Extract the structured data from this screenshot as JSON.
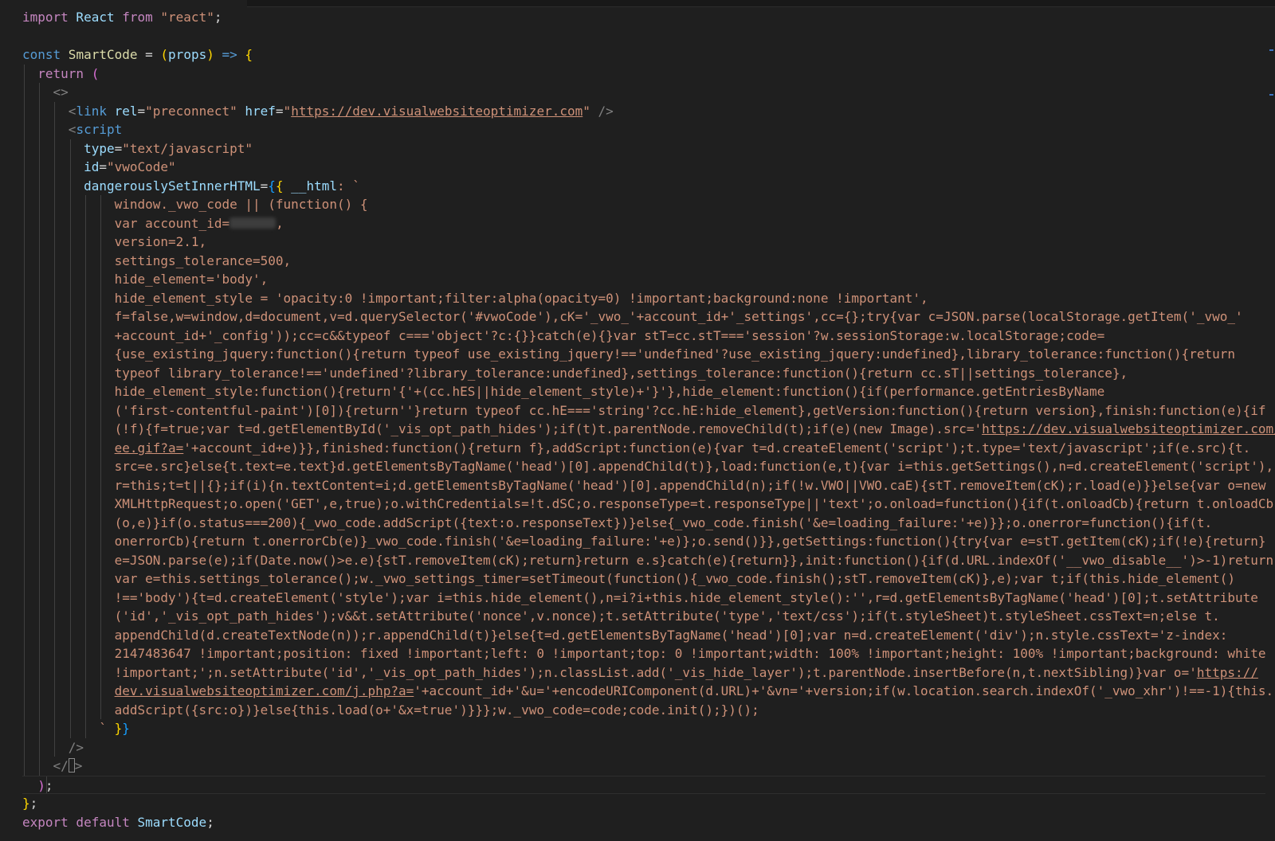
{
  "editor": {
    "file_language": "JSX",
    "lines": [
      [
        [
          "import",
          "ctl"
        ],
        [
          " React ",
          "var"
        ],
        [
          "from",
          "ctl"
        ],
        [
          " \"react\"",
          "str"
        ],
        [
          ";",
          "txt"
        ]
      ],
      [],
      [
        [
          "const",
          "kw"
        ],
        [
          " SmartCode",
          "fn"
        ],
        [
          " = ",
          "txt"
        ],
        [
          "(",
          "br1"
        ],
        [
          "props",
          "var"
        ],
        [
          ")",
          "br1"
        ],
        [
          " => ",
          "kw"
        ],
        [
          "{",
          "br1"
        ]
      ],
      [
        [
          "  ",
          "txt"
        ],
        [
          "return",
          "ctl"
        ],
        [
          " ",
          "txt"
        ],
        [
          "(",
          "br2"
        ]
      ],
      [
        [
          "    ",
          "txt"
        ],
        [
          "<>",
          "tag"
        ]
      ],
      [
        [
          "      ",
          "txt"
        ],
        [
          "<",
          "tag"
        ],
        [
          "link",
          "tagname"
        ],
        [
          " rel",
          "attr"
        ],
        [
          "=",
          "txt"
        ],
        [
          "\"preconnect\"",
          "str"
        ],
        [
          " href",
          "attr"
        ],
        [
          "=",
          "txt"
        ],
        [
          "\"",
          "str"
        ],
        [
          "https://dev.visualwebsiteoptimizer.com",
          "link"
        ],
        [
          "\"",
          "str"
        ],
        [
          " />",
          "tag"
        ]
      ],
      [
        [
          "      ",
          "txt"
        ],
        [
          "<",
          "tag"
        ],
        [
          "script",
          "tagname"
        ]
      ],
      [
        [
          "        ",
          "txt"
        ],
        [
          "type",
          "attr"
        ],
        [
          "=",
          "txt"
        ],
        [
          "\"text/javascript\"",
          "str"
        ]
      ],
      [
        [
          "        ",
          "txt"
        ],
        [
          "id",
          "attr"
        ],
        [
          "=",
          "txt"
        ],
        [
          "\"vwoCode\"",
          "str"
        ]
      ],
      [
        [
          "        ",
          "txt"
        ],
        [
          "dangerouslySetInnerHTML",
          "attr"
        ],
        [
          "=",
          "txt"
        ],
        [
          "{",
          "br3"
        ],
        [
          "{",
          "br1"
        ],
        [
          " __html",
          "var"
        ],
        [
          ": `",
          "str"
        ]
      ],
      [
        [
          "            window._vwo_code || (function() {",
          "str"
        ]
      ],
      [
        [
          "            var account_id=",
          "str"
        ],
        [
          "[blur]",
          "blur"
        ],
        [
          ",",
          "str"
        ]
      ],
      [
        [
          "            version=2.1,",
          "str"
        ]
      ],
      [
        [
          "            settings_tolerance=500,",
          "str"
        ]
      ],
      [
        [
          "            hide_element='body',",
          "str"
        ]
      ],
      [
        [
          "            hide_element_style = 'opacity:0 !important;filter:alpha(opacity=0) !important;background:none !important',",
          "str"
        ]
      ],
      [
        [
          "            f=false,w=window,d=document,v=d.querySelector('#vwoCode'),cK='_vwo_'+account_id+'_settings',cc={};try{var c=JSON.parse(localStorage.getItem('_vwo_'",
          "str"
        ]
      ],
      [
        [
          "            +account_id+'_config'));cc=c&&typeof c==='object'?c:{}}catch(e){}var stT=cc.stT==='session'?w.sessionStorage:w.localStorage;code=",
          "str"
        ]
      ],
      [
        [
          "            {use_existing_jquery:function(){return typeof use_existing_jquery!=='undefined'?use_existing_jquery:undefined},library_tolerance:function(){return",
          "str"
        ]
      ],
      [
        [
          "            typeof library_tolerance!=='undefined'?library_tolerance:undefined},settings_tolerance:function(){return cc.sT||settings_tolerance},",
          "str"
        ]
      ],
      [
        [
          "            hide_element_style:function(){return'{'+(cc.hES||hide_element_style)+'}'},hide_element:function(){if(performance.getEntriesByName",
          "str"
        ]
      ],
      [
        [
          "            ('first-contentful-paint')[0]){return''}return typeof cc.hE==='string'?cc.hE:hide_element},getVersion:function(){return version},finish:function(e){if",
          "str"
        ]
      ],
      [
        [
          "            (!f){f=true;var t=d.getElementById('_vis_opt_path_hides');if(t)t.parentNode.removeChild(t);if(e)(new Image).src='",
          "str"
        ],
        [
          "https://dev.visualwebsiteoptimizer.com/",
          "link"
        ]
      ],
      [
        [
          "            ",
          "str"
        ],
        [
          "ee.gif?a=",
          "link"
        ],
        [
          "'+account_id+e)}},finished:function(){return f},addScript:function(e){var t=d.createElement('script');t.type='text/javascript';if(e.src){t.",
          "str"
        ]
      ],
      [
        [
          "            src=e.src}else{t.text=e.text}d.getElementsByTagName('head')[0].appendChild(t)},load:function(e,t){var i=this.getSettings(),n=d.createElement('script'),",
          "str"
        ]
      ],
      [
        [
          "            r=this;t=t||{};if(i){n.textContent=i;d.getElementsByTagName('head')[0].appendChild(n);if(!w.VWO||VWO.caE){stT.removeItem(cK);r.load(e)}}else{var o=new",
          "str"
        ]
      ],
      [
        [
          "            XMLHttpRequest;o.open('GET',e,true);o.withCredentials=!t.dSC;o.responseType=t.responseType||'text';o.onload=function(){if(t.onloadCb){return t.onloadCb",
          "str"
        ]
      ],
      [
        [
          "            (o,e)}if(o.status===200){_vwo_code.addScript({text:o.responseText})}else{_vwo_code.finish('&e=loading_failure:'+e)}};o.onerror=function(){if(t.",
          "str"
        ]
      ],
      [
        [
          "            onerrorCb){return t.onerrorCb(e)}_vwo_code.finish('&e=loading_failure:'+e)};o.send()}},getSettings:function(){try{var e=stT.getItem(cK);if(!e){return}",
          "str"
        ]
      ],
      [
        [
          "            e=JSON.parse(e);if(Date.now()>e.e){stT.removeItem(cK);return}return e.s}catch(e){return}},init:function(){if(d.URL.indexOf('__vwo_disable__')>-1)return;",
          "str"
        ]
      ],
      [
        [
          "            var e=this.settings_tolerance();w._vwo_settings_timer=setTimeout(function(){_vwo_code.finish();stT.removeItem(cK)},e);var t;if(this.hide_element()",
          "str"
        ]
      ],
      [
        [
          "            !=='body'){t=d.createElement('style');var i=this.hide_element(),n=i?i+this.hide_element_style():'',r=d.getElementsByTagName('head')[0];t.setAttribute",
          "str"
        ]
      ],
      [
        [
          "            ('id','_vis_opt_path_hides');v&&t.setAttribute('nonce',v.nonce);t.setAttribute('type','text/css');if(t.styleSheet)t.styleSheet.cssText=n;else t.",
          "str"
        ]
      ],
      [
        [
          "            appendChild(d.createTextNode(n));r.appendChild(t)}else{t=d.getElementsByTagName('head')[0];var n=d.createElement('div');n.style.cssText='z-index:",
          "str"
        ]
      ],
      [
        [
          "            2147483647 !important;position: fixed !important;left: 0 !important;top: 0 !important;width: 100% !important;height: 100% !important;background: white",
          "str"
        ]
      ],
      [
        [
          "            !important;';n.setAttribute('id','_vis_opt_path_hides');n.classList.add('_vis_hide_layer');t.parentNode.insertBefore(n,t.nextSibling)}var o='",
          "str"
        ],
        [
          "https://",
          "link"
        ]
      ],
      [
        [
          "            ",
          "str"
        ],
        [
          "dev.visualwebsiteoptimizer.com/j.php?a=",
          "link"
        ],
        [
          "'+account_id+'&u='+encodeURIComponent(d.URL)+'&vn='+version;if(w.location.search.indexOf('_vwo_xhr')!==-1){this.",
          "str"
        ]
      ],
      [
        [
          "            addScript({src:o})}else{this.load(o+'&x=true')}}};w._vwo_code=code;code.init();})();",
          "str"
        ]
      ],
      [
        [
          "          ` ",
          "str"
        ],
        [
          "}",
          "br1"
        ],
        [
          "}",
          "br3"
        ]
      ],
      [
        [
          "      ",
          "txt"
        ],
        [
          "/>",
          "tag"
        ]
      ],
      [
        [
          "    ",
          "txt"
        ],
        [
          "</",
          "tag"
        ],
        [
          "[cursor]",
          "cursor"
        ],
        [
          ">",
          "tag"
        ]
      ],
      [
        [
          "  ",
          "txt"
        ],
        [
          ")",
          "br2"
        ],
        [
          ";",
          "txt"
        ]
      ],
      [
        [
          "}",
          "br1"
        ],
        [
          ";",
          "txt"
        ]
      ],
      [
        [
          "export",
          "ctl"
        ],
        [
          " default",
          "ctl"
        ],
        [
          " SmartCode",
          "var"
        ],
        [
          ";",
          "txt"
        ]
      ]
    ],
    "current_line": 41
  }
}
